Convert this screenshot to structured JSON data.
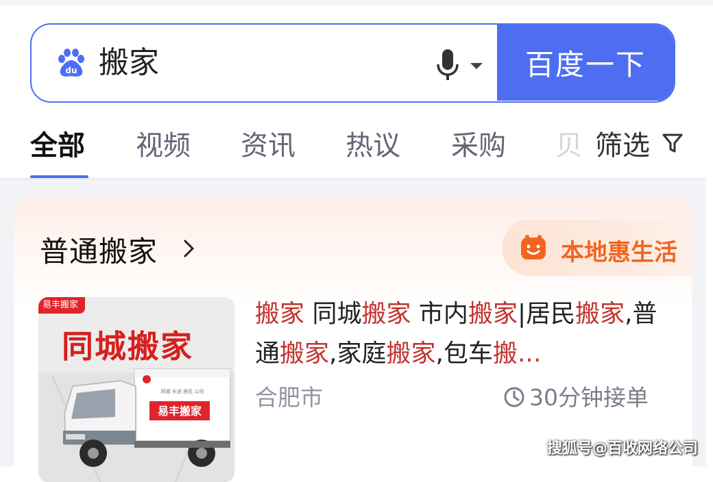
{
  "search": {
    "query": "搬家",
    "button_label": "百度一下"
  },
  "tabs": [
    {
      "label": "全部",
      "active": true
    },
    {
      "label": "视频"
    },
    {
      "label": "资讯"
    },
    {
      "label": "热议"
    },
    {
      "label": "采购"
    },
    {
      "label": "贝"
    }
  ],
  "filter": {
    "label": "筛选"
  },
  "card": {
    "title": "普通搬家",
    "badge_label": "本地惠生活",
    "thumb": {
      "brand_tag": "易丰搬家",
      "headline": "同城搬家",
      "truck_brand": "易丰搬家",
      "truck_services": "同城 长途 居民 公司"
    },
    "result": {
      "title_parts": [
        {
          "text": "搬家",
          "hl": true
        },
        {
          "text": " 同城",
          "hl": false
        },
        {
          "text": "搬家",
          "hl": true
        },
        {
          "text": " 市内",
          "hl": false
        },
        {
          "text": "搬家",
          "hl": true
        },
        {
          "text": "|居民",
          "hl": false
        },
        {
          "text": "搬家",
          "hl": true
        },
        {
          "text": ",普通",
          "hl": false
        },
        {
          "text": "搬家",
          "hl": true
        },
        {
          "text": ",家庭",
          "hl": false
        },
        {
          "text": "搬家",
          "hl": true
        },
        {
          "text": ",包车",
          "hl": false
        },
        {
          "text": "搬...",
          "hl": true
        }
      ],
      "location": "合肥市",
      "response_time": "30分钟接单"
    }
  },
  "watermark": "搜狐号@百收网络公司",
  "colors": {
    "accent": "#4e6ef2",
    "highlight": "#c2322e",
    "badge_orange": "#f26520"
  }
}
